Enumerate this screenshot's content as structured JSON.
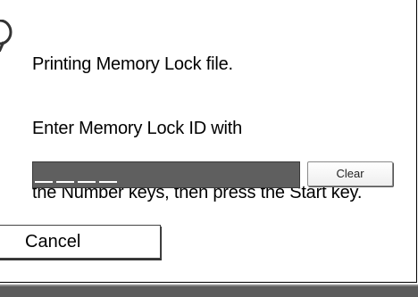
{
  "dialog": {
    "message_lines": [
      "Printing Memory Lock file.",
      "Enter Memory Lock ID with",
      "the Number keys, then press the Start key."
    ],
    "id_input": {
      "value": "",
      "slots": 4
    },
    "clear_label": "Clear",
    "cancel_label": "Cancel"
  },
  "icons": {
    "message_icon": "info-icon"
  },
  "colors": {
    "input_background": "#5f5f5f",
    "footer_bar": "#5c5c5c"
  }
}
